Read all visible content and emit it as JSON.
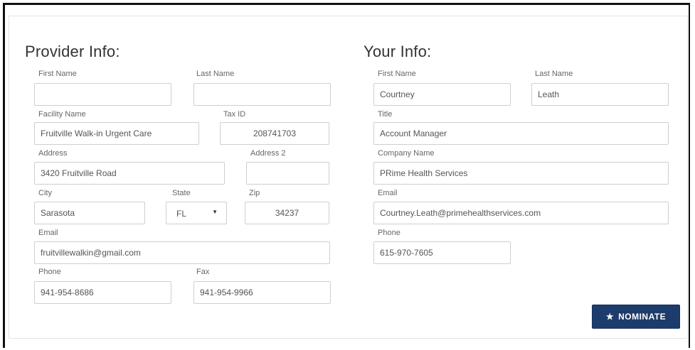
{
  "provider": {
    "heading": "Provider Info:",
    "first_name": {
      "label": "First Name",
      "value": ""
    },
    "last_name": {
      "label": "Last Name",
      "value": ""
    },
    "facility_name": {
      "label": "Facility Name",
      "value": "Fruitville Walk-in Urgent Care"
    },
    "tax_id": {
      "label": "Tax ID",
      "value": "208741703"
    },
    "address": {
      "label": "Address",
      "value": "3420 Fruitville Road"
    },
    "address2": {
      "label": "Address 2",
      "value": ""
    },
    "city": {
      "label": "City",
      "value": "Sarasota"
    },
    "state": {
      "label": "State",
      "value": "FL"
    },
    "zip": {
      "label": "Zip",
      "value": "34237"
    },
    "email": {
      "label": "Email",
      "value": "fruitvillewalkin@gmail.com"
    },
    "phone": {
      "label": "Phone",
      "value": "941-954-8686"
    },
    "fax": {
      "label": "Fax",
      "value": "941-954-9966"
    }
  },
  "you": {
    "heading": "Your Info:",
    "first_name": {
      "label": "First Name",
      "value": "Courtney"
    },
    "last_name": {
      "label": "Last Name",
      "value": "Leath"
    },
    "title": {
      "label": "Title",
      "value": "Account Manager"
    },
    "company": {
      "label": "Company Name",
      "value": "PRime Health Services"
    },
    "email": {
      "label": "Email",
      "value": "Courtney.Leath@primehealthservices.com"
    },
    "phone": {
      "label": "Phone",
      "value": "615-970-7605"
    }
  },
  "nominate_button": {
    "label": "NOMINATE",
    "icon": "star-icon"
  }
}
